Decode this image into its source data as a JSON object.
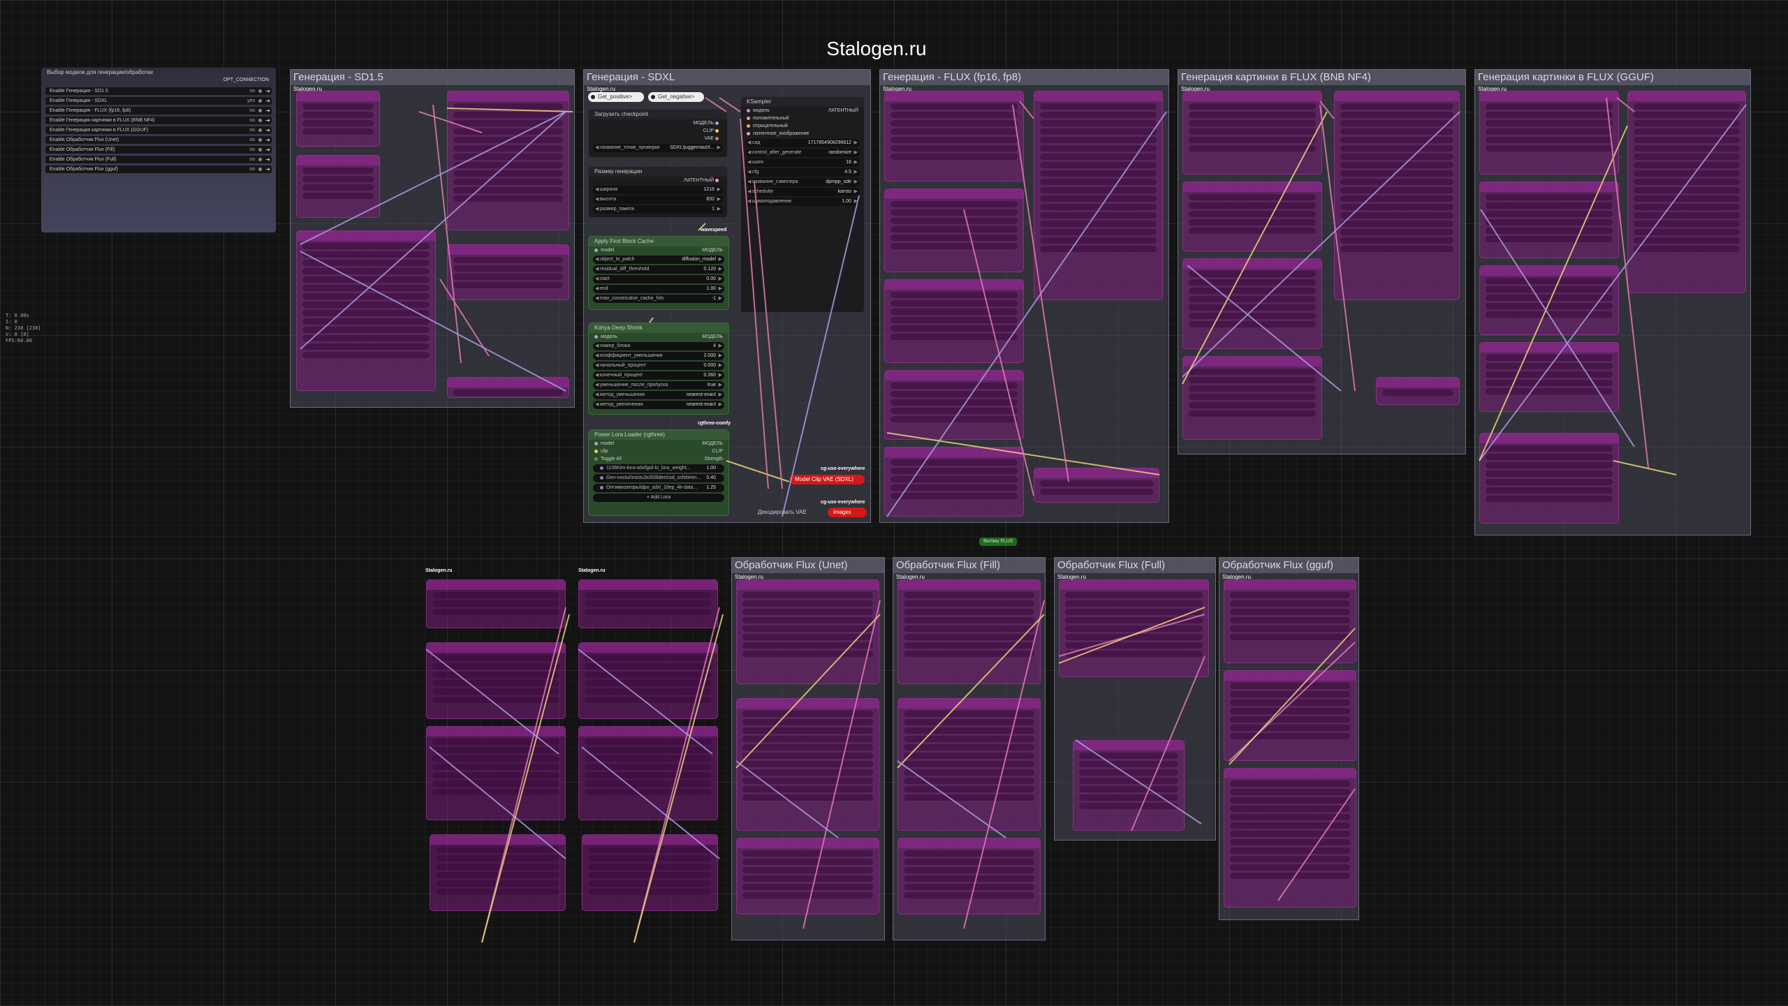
{
  "page_title": "Stalogen.ru",
  "debug_overlay": "T: 0.00s\nI: 0\nN: 238 [238]\nV: 0 [0]\nFPS:60.00",
  "selector": {
    "title": "Выбор модели для генерации/обработки",
    "output_label": "OPT_CONNECTION",
    "rows": [
      {
        "label": "Enable Генерация - SD1.5",
        "value": "no"
      },
      {
        "label": "Enable Генерация - SDXL",
        "value": "yes"
      },
      {
        "label": "Enable Генерация - FLUX (fp16, fp8)",
        "value": "no"
      },
      {
        "label": "Enable Генерация картинки в FLUX (BNB NF4)",
        "value": "no"
      },
      {
        "label": "Enable Генерация картинки в FLUX (GGUF)",
        "value": "no"
      },
      {
        "label": "Enable Обработчик Flux (Unet)",
        "value": "no"
      },
      {
        "label": "Enable Обработчик Flux (Fill)",
        "value": "no"
      },
      {
        "label": "Enable Обработчик Flux (Full)",
        "value": "no"
      },
      {
        "label": "Enable Обработчик Flux (gguf)",
        "value": "no"
      }
    ]
  },
  "group_sub": "Stalogen.ru",
  "groups": {
    "sd15": "Генерация - SD1.5",
    "sdxl": "Генерация - SDXL",
    "flux16": "Генерация - FLUX (fp16, fp8)",
    "nf4": "Генерация картинки в FLUX (BNB NF4)",
    "gguf": "Генерация картинки в FLUX (GGUF)",
    "unet": "Обработчик Flux (Unet)",
    "fill": "Обработчик Flux (Fill)",
    "full": "Обработчик Flux (Full)",
    "pgguf": "Обработчик Flux (gguf)"
  },
  "sdxl": {
    "get_positive": "Get_positive>",
    "get_negative": "Get_negative>",
    "checkpoint": {
      "title": "Загрузить checkpoint",
      "outputs": [
        "МОДЕЛЬ",
        "CLIP",
        "VAE"
      ],
      "widget_label": "название_точки_проверки",
      "widget_value": "SDXL\\juggernautX..."
    },
    "size": {
      "title": "Размер генерации",
      "output": "ЛАТЕНТНЫЙ",
      "rows": [
        {
          "label": "ширина",
          "value": "1216"
        },
        {
          "label": "высота",
          "value": "832"
        },
        {
          "label": "размер_пакета",
          "value": "1"
        }
      ]
    },
    "wavespeed_label": "wavespeed",
    "fbcache": {
      "title": "Apply First Block Cache",
      "input": "model",
      "output": "МОДЕЛЬ",
      "rows": [
        {
          "label": "object_to_patch",
          "value": "diffusion_model"
        },
        {
          "label": "residual_diff_threshold",
          "value": "0.120"
        },
        {
          "label": "start",
          "value": "0.00"
        },
        {
          "label": "end",
          "value": "1.00"
        },
        {
          "label": "max_consecutive_cache_hits",
          "value": "-1"
        }
      ]
    },
    "kohya": {
      "title": "Kohya Deep Shrink",
      "input": "модель",
      "output": "МОДЕЛЬ",
      "rows": [
        {
          "label": "номер_блока",
          "value": "4"
        },
        {
          "label": "коэффициент_уменьшения",
          "value": "2.000"
        },
        {
          "label": "начальный_процент",
          "value": "0.000"
        },
        {
          "label": "конечный_процент",
          "value": "0.360"
        },
        {
          "label": "уменьшение_после_пропуска",
          "value": "true"
        },
        {
          "label": "метод_уменьшения",
          "value": "nearest-exact"
        },
        {
          "label": "метод_увеличения",
          "value": "nearest-exact"
        }
      ]
    },
    "rgthree_label": "rgthree-comfy",
    "lora": {
      "title": "Power Lora Loader (rgthree)",
      "inputs": [
        "model",
        "clip"
      ],
      "outputs": [
        "МОДЕЛЬ",
        "CLIP"
      ],
      "toggle_label": "Toggle All",
      "strength_label": "Strength",
      "loras": [
        {
          "name": "1136Kim-lora-sdxl\\jpd-lo_lora_weight...",
          "value": "1.00"
        },
        {
          "name": "Gen-noctuI\\noctu3x3\\Sliders\\sd_ssfxbimn...",
          "value": "0.40"
        },
        {
          "name": "Оптимизаторы\\dpo_sdxl_10ep_4k-data...",
          "value": "1.25"
        }
      ],
      "add_label": "+ Add Lora"
    },
    "ksampler": {
      "title": "KSampler",
      "inputs": [
        "модель",
        "положительный",
        "отрицательный",
        "латентное_изображение"
      ],
      "output": "ЛАТЕНТНЫЙ",
      "rows": [
        {
          "label": "сид",
          "value": "1717854908296612"
        },
        {
          "label": "control_after_generate",
          "value": "randomize"
        },
        {
          "label": "шаги",
          "value": "16"
        },
        {
          "label": "cfg",
          "value": "4.5"
        },
        {
          "label": "название_сэмплера",
          "value": "dpmpp_sde"
        },
        {
          "label": "scheduler",
          "value": "karras"
        },
        {
          "label": "шумоподавление",
          "value": "1.00"
        }
      ]
    },
    "cg_label": "cg-use-everywhere",
    "model_clip_vae": "Model Clip VAE (SDXL)",
    "vae_decode": "Декодировать VAE",
    "images": "images"
  },
  "green_button": "Вкл\\вы FLUX",
  "cg_small": "cg-use-everywhere",
  "rgthree_small": "rgthree-comfy",
  "add_lora_small": "+ Add Lora",
  "stalogen_small": "Stalogen.ru",
  "model_small": "МОДЕЛЬ",
  "colors": {
    "accent_red": "#d41818",
    "node_mute": "#7a1e7a",
    "group_bg": "#4a4a5a",
    "wire_yellow": "#e8d27a",
    "wire_pink": "#e07ab0",
    "wire_lavender": "#a89ae0"
  }
}
